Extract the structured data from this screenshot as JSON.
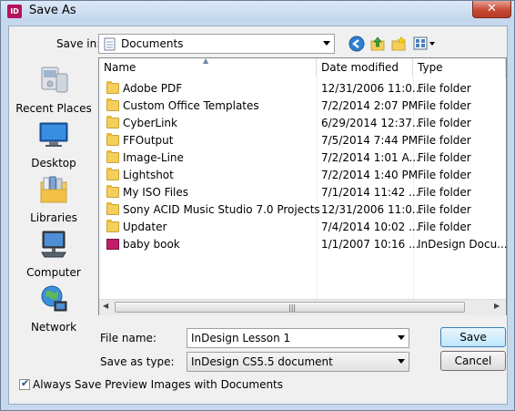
{
  "window": {
    "title": "Save As",
    "app_icon": "ID",
    "close": "✕"
  },
  "toolbar": {
    "save_in_label": "Save in:",
    "save_in_value": "Documents"
  },
  "places": [
    {
      "label": "Recent Places",
      "icon": "recent-places-icon"
    },
    {
      "label": "Desktop",
      "icon": "desktop-icon"
    },
    {
      "label": "Libraries",
      "icon": "libraries-icon"
    },
    {
      "label": "Computer",
      "icon": "computer-icon"
    },
    {
      "label": "Network",
      "icon": "network-icon"
    }
  ],
  "columns": {
    "name": "Name",
    "date": "Date modified",
    "type": "Type"
  },
  "files": [
    {
      "name": "Adobe PDF",
      "date": "12/31/2006 11:0...",
      "type": "File folder",
      "kind": "folder"
    },
    {
      "name": "Custom Office Templates",
      "date": "7/2/2014 2:07 PM",
      "type": "File folder",
      "kind": "folder"
    },
    {
      "name": "CyberLink",
      "date": "6/29/2014 12:37...",
      "type": "File folder",
      "kind": "folder"
    },
    {
      "name": "FFOutput",
      "date": "7/5/2014 7:44 PM",
      "type": "File folder",
      "kind": "folder"
    },
    {
      "name": "Image-Line",
      "date": "7/2/2014 1:01 A...",
      "type": "File folder",
      "kind": "folder"
    },
    {
      "name": "Lightshot",
      "date": "7/2/2014 1:40 PM",
      "type": "File folder",
      "kind": "folder"
    },
    {
      "name": "My ISO Files",
      "date": "7/1/2014 11:42 ...",
      "type": "File folder",
      "kind": "folder"
    },
    {
      "name": "Sony ACID Music Studio 7.0 Projects",
      "date": "12/31/2006 11:0...",
      "type": "File folder",
      "kind": "folder"
    },
    {
      "name": "Updater",
      "date": "7/4/2014 10:02 ...",
      "type": "File folder",
      "kind": "folder"
    },
    {
      "name": "baby book",
      "date": "1/1/2007 10:16 ...",
      "type": "InDesign Docu...",
      "kind": "indd"
    }
  ],
  "form": {
    "file_name_label": "File name:",
    "file_name_value": "InDesign Lesson 1",
    "save_type_label": "Save as type:",
    "save_type_value": "InDesign CS5.5 document",
    "save_button": "Save",
    "cancel_button": "Cancel",
    "preview_checkbox_label": "Always Save Preview Images with Documents",
    "preview_checked": true
  }
}
